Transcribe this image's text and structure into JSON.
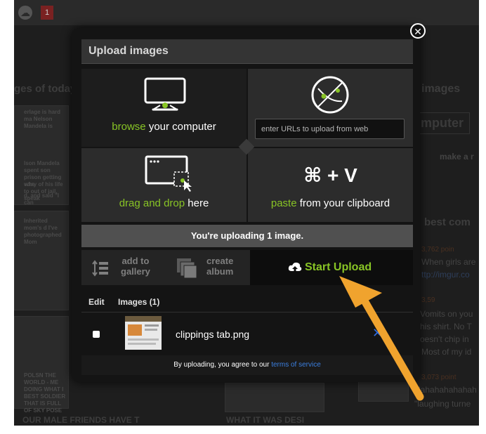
{
  "background": {
    "badge": "1",
    "snippets": [
      "ges of today, a",
      "images",
      "mputer",
      "make a r",
      "best com",
      "3,762 poin",
      "When girls are",
      "ttp://imgur.co",
      "3,59",
      "Vomits on you",
      "his shirt. No T",
      "oesn't chip in",
      "Most of my id",
      "3,073 point",
      "Hahahahahahah",
      "\"laughing turne",
      "OUR MALE FRIENDS HAVE T",
      "WHAT IT WAS DESI"
    ],
    "thumb_captions": [
      "erlage is hard ma Nelson Mandela is",
      "lson Mandela spent son prison getting whe",
      "vday of his life to out of jail, speak",
      "d, and said \"I can",
      "Inherited mom's d I've photographed Mom",
      "POLSN THE WORLD - ME DOING WHAT I BEST SOLDIER THAT IS FULL OF SKY POSE"
    ]
  },
  "modal": {
    "title": "Upload images",
    "tiles": {
      "browse_green": "browse",
      "browse_rest": " your computer",
      "url_placeholder": "enter URLs to upload from web",
      "drag_green": "drag and drop",
      "drag_rest": " here",
      "paste_keys": "⌘ + V",
      "paste_green": "paste",
      "paste_rest": " from your clipboard"
    },
    "status": "You're uploading 1 image.",
    "actions": {
      "gallery_line1": "add to",
      "gallery_line2": "gallery",
      "album_line1": "create",
      "album_line2": "album",
      "start_upload": "Start Upload"
    },
    "list": {
      "edit_header": "Edit",
      "images_header": "Images (1)",
      "file_name": "clippings tab.png",
      "remove": "✕"
    },
    "footer_prefix": "By uploading, you agree to our ",
    "footer_link": "terms of service"
  },
  "colors": {
    "accent_green": "#88c425",
    "link_blue": "#3b7fe0",
    "arrow_orange": "#f0a32e"
  }
}
